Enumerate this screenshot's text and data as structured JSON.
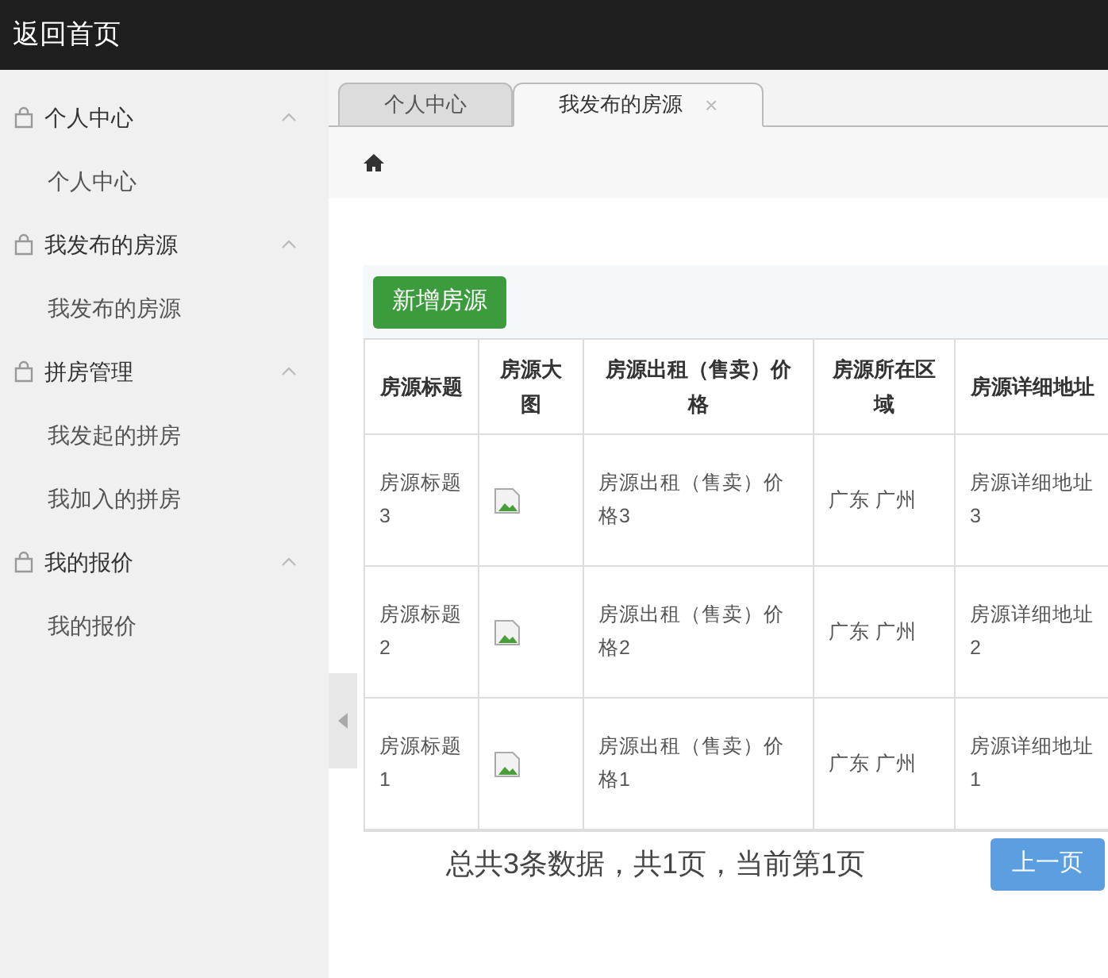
{
  "header": {
    "title": "返回首页"
  },
  "sidebar": {
    "groups": [
      {
        "label": "个人中心",
        "expanded": true,
        "items": [
          {
            "label": "个人中心"
          }
        ]
      },
      {
        "label": "我发布的房源",
        "expanded": true,
        "items": [
          {
            "label": "我发布的房源"
          }
        ]
      },
      {
        "label": "拼房管理",
        "expanded": true,
        "items": [
          {
            "label": "我发起的拼房"
          },
          {
            "label": "我加入的拼房"
          }
        ]
      },
      {
        "label": "我的报价",
        "expanded": true,
        "items": [
          {
            "label": "我的报价"
          }
        ]
      }
    ]
  },
  "tabs": [
    {
      "label": "个人中心",
      "selected": false,
      "closable": false
    },
    {
      "label": "我发布的房源",
      "selected": true,
      "closable": true,
      "close": "×"
    }
  ],
  "add_button": "新增房源",
  "table": {
    "columns": [
      "房源标题",
      "房源大图",
      "房源出租（售卖）价格",
      "房源所在区域",
      "房源详细地址"
    ],
    "rows": [
      [
        "房源标题3",
        "",
        "房源出租（售卖）价格3",
        "广东 广州",
        "房源详细地址3"
      ],
      [
        "房源标题2",
        "",
        "房源出租（售卖）价格2",
        "广东 广州",
        "房源详细地址2"
      ],
      [
        "房源标题1",
        "",
        "房源出租（售卖）价格1",
        "广东 广州",
        "房源详细地址1"
      ]
    ]
  },
  "pagination": {
    "summary": "总共3条数据，共1页，当前第1页",
    "prev": "上一页"
  }
}
